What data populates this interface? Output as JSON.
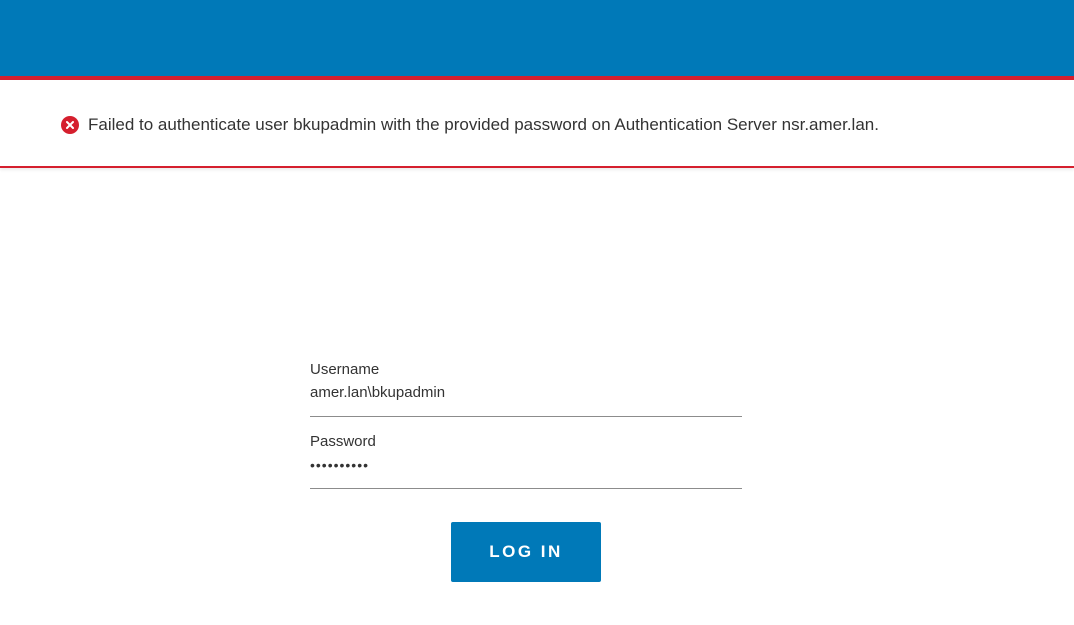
{
  "colors": {
    "header_bg": "#0079b8",
    "accent_red": "#d51f2e",
    "button_bg": "#0079b8"
  },
  "error": {
    "icon": "error-circle-x-icon",
    "message": "Failed to authenticate user bkupadmin with the provided password on Authentication Server nsr.amer.lan."
  },
  "form": {
    "username_label": "Username",
    "username_value": "amer.lan\\bkupadmin",
    "password_label": "Password",
    "password_masked": "••••••••••",
    "login_label": "LOG IN"
  }
}
